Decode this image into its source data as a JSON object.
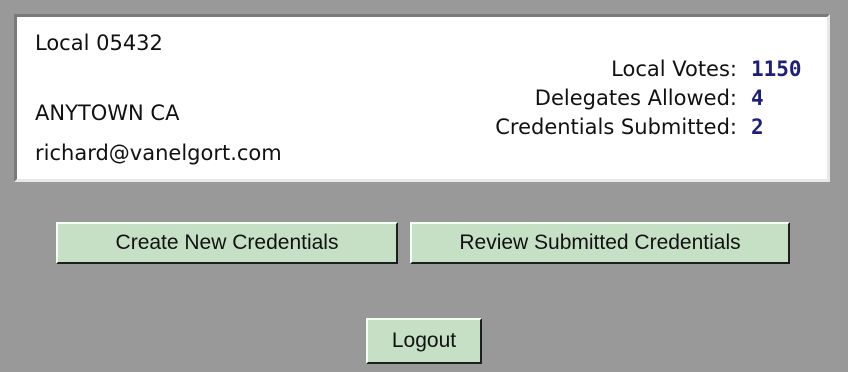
{
  "local": {
    "name": "Local 05432",
    "city": "ANYTOWN CA",
    "email": "richard@vanelgort.com"
  },
  "stats": [
    {
      "label": "Local Votes:",
      "value": "1150"
    },
    {
      "label": "Delegates Allowed:",
      "value": "4"
    },
    {
      "label": "Credentials Submitted:",
      "value": "2"
    }
  ],
  "buttons": {
    "create": "Create New Credentials",
    "review": "Review Submitted Credentials",
    "logout": "Logout"
  },
  "colors": {
    "background": "#999999",
    "button_face": "#c6e0c6",
    "value_text": "#1f1f7a"
  }
}
